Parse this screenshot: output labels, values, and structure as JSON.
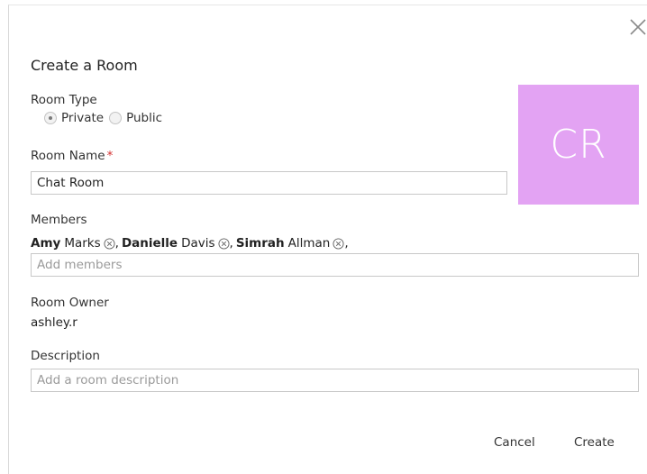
{
  "dialog": {
    "title": "Create a Room",
    "close_icon": "close-icon"
  },
  "room_type": {
    "label": "Room Type",
    "options": [
      {
        "label": "Private",
        "selected": true
      },
      {
        "label": "Public",
        "selected": false
      }
    ]
  },
  "room_name": {
    "label": "Room Name",
    "required_mark": "*",
    "value": "Chat Room"
  },
  "avatar": {
    "initials": "CR",
    "color": "#e3a3f3"
  },
  "members": {
    "label": "Members",
    "list": [
      {
        "first": "Amy",
        "last": "Marks"
      },
      {
        "first": "Danielle",
        "last": "Davis"
      },
      {
        "first": "Simrah",
        "last": "Allman"
      }
    ],
    "input_placeholder": "Add members"
  },
  "owner": {
    "label": "Room Owner",
    "value": "ashley.r"
  },
  "description": {
    "label": "Description",
    "placeholder": "Add a room description"
  },
  "actions": {
    "cancel_label": "Cancel",
    "create_label": "Create"
  },
  "colors": {
    "required": "#d32f2f",
    "border": "#c8c8c8"
  }
}
